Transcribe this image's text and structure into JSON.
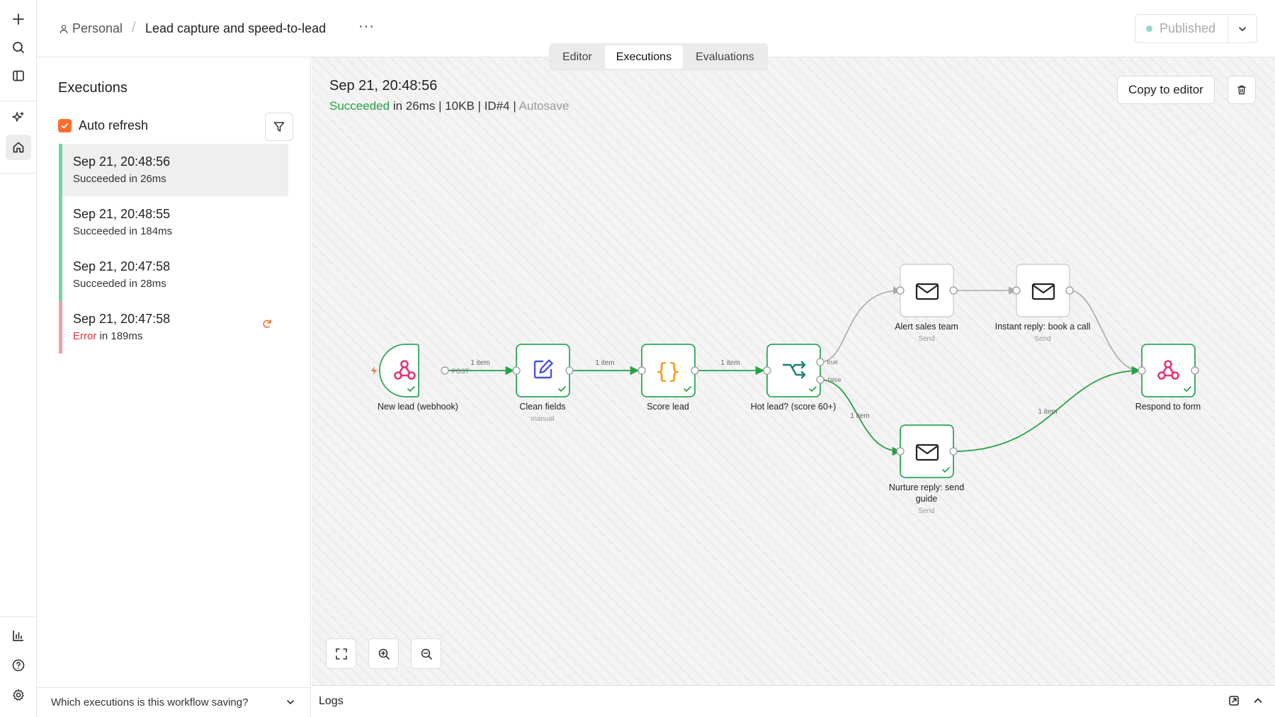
{
  "rail": {
    "icons": [
      "plus-icon",
      "search-icon",
      "sidebar-toggle-icon",
      "sparkles-icon",
      "home-icon",
      "insights-icon",
      "help-icon",
      "settings-icon"
    ]
  },
  "header": {
    "project": "Personal",
    "workflow_title": "Lead capture and speed-to-lead",
    "more_label": "···",
    "tabs": [
      {
        "label": "Editor",
        "active": false
      },
      {
        "label": "Executions",
        "active": true
      },
      {
        "label": "Evaluations",
        "active": false
      }
    ],
    "publish_label": "Published"
  },
  "executions": {
    "heading": "Executions",
    "auto_refresh_label": "Auto refresh",
    "auto_refresh_checked": true,
    "items": [
      {
        "time": "Sep 21, 20:48:56",
        "status": "Succeeded",
        "duration": "in 26ms",
        "state": "success",
        "selected": true
      },
      {
        "time": "Sep 21, 20:48:55",
        "status": "Succeeded",
        "duration": "in 184ms",
        "state": "success",
        "selected": false
      },
      {
        "time": "Sep 21, 20:47:58",
        "status": "Succeeded",
        "duration": "in 28ms",
        "state": "success",
        "selected": false
      },
      {
        "time": "Sep 21, 20:47:58",
        "status": "Error",
        "duration": "in 189ms",
        "state": "error",
        "selected": false
      }
    ],
    "footer_question": "Which executions is this workflow saving?"
  },
  "run": {
    "title": "Sep 21, 20:48:56",
    "status": "Succeeded",
    "duration": "in 26ms",
    "size": "10KB",
    "id": "ID#4",
    "mode": "Autosave",
    "copy_label": "Copy to editor"
  },
  "workflow": {
    "nodes": [
      {
        "id": "webhook",
        "label": "New lead (webhook)",
        "subtitle": "",
        "icon": "webhook-icon",
        "executed": true
      },
      {
        "id": "clean",
        "label": "Clean fields",
        "subtitle": "manual",
        "icon": "edit-icon",
        "executed": true
      },
      {
        "id": "score",
        "label": "Score lead",
        "subtitle": "",
        "icon": "code-braces-icon",
        "executed": true
      },
      {
        "id": "if",
        "label": "Hot lead? (score 60+)",
        "subtitle": "",
        "icon": "branch-icon",
        "executed": true
      },
      {
        "id": "alert",
        "label": "Alert sales team",
        "subtitle": "Send",
        "icon": "mail-icon",
        "executed": false
      },
      {
        "id": "instant",
        "label": "Instant reply: book a call",
        "subtitle": "Send",
        "icon": "mail-icon",
        "executed": false
      },
      {
        "id": "nurture",
        "label": "Nurture reply: send guide",
        "subtitle": "Send",
        "icon": "mail-icon",
        "executed": true
      },
      {
        "id": "respond",
        "label": "Respond to form",
        "subtitle": "",
        "icon": "webhook-icon",
        "executed": true
      }
    ],
    "edge_labels": {
      "item": "1 item",
      "post": "POST",
      "true": "true",
      "false": "false"
    }
  },
  "logs_label": "Logs",
  "colors": {
    "success": "#25a244",
    "error": "#e0323d",
    "accent": "#ff6d2d",
    "node_success_border": "#2da85a"
  }
}
